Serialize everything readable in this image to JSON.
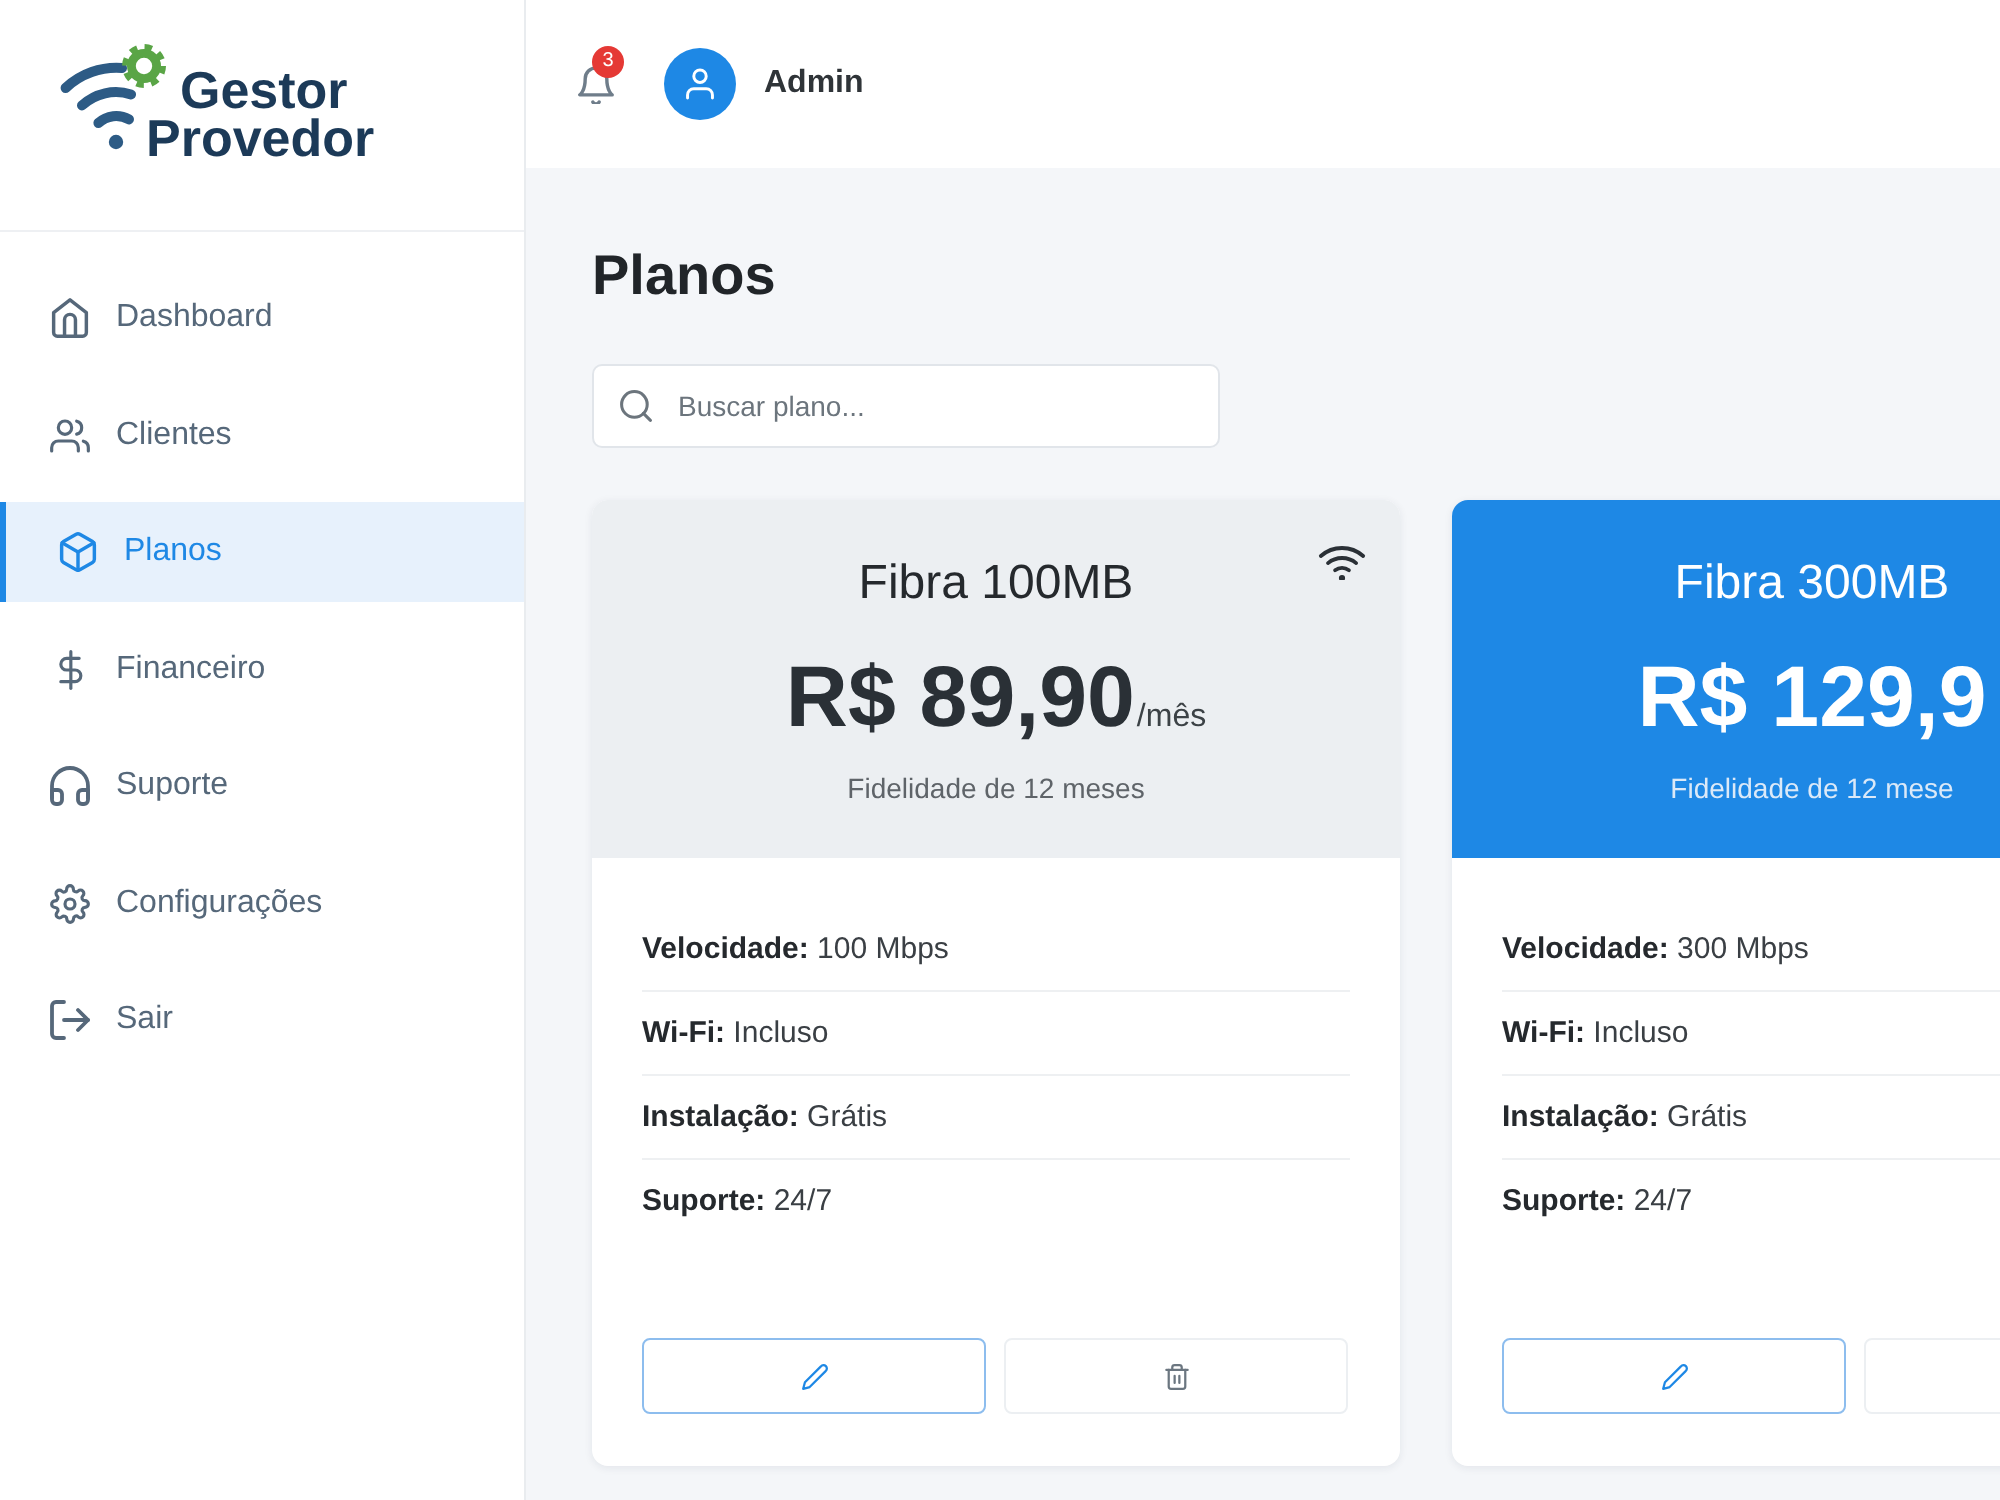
{
  "logo": [
    "Gestor",
    "Provedor"
  ],
  "sidebar": {
    "items": [
      {
        "kind": "home",
        "label": "Dashboard",
        "selected": false
      },
      {
        "kind": "users",
        "label": "Clientes",
        "selected": false
      },
      {
        "kind": "box",
        "label": "Planos",
        "selected": true
      },
      {
        "kind": "dollar",
        "label": "Financeiro",
        "selected": false
      },
      {
        "kind": "headphones",
        "label": "Suporte",
        "selected": false
      },
      {
        "kind": "gear",
        "label": "Configurações",
        "selected": false
      },
      {
        "kind": "logout",
        "label": "Sair",
        "selected": false
      }
    ]
  },
  "topbar": {
    "notification_count": "3",
    "user_name": "Admin"
  },
  "page": {
    "title": "Planos",
    "search": {
      "placeholder": "Buscar plano..."
    }
  },
  "plans": [
    {
      "name": "Fibra 100MB",
      "highlighted": false,
      "corner_icon": true,
      "price": "R$ 89,90",
      "period": "/mês",
      "note": "Fidelidade de 12 meses",
      "features": [
        "**Velocidade:** 100 Mbps",
        "**Wi-Fi:** Incluso",
        "**Instalação:** Grátis",
        "**Suporte:** 24/7"
      ],
      "actions": [
        {
          "kind": "edit"
        },
        {
          "kind": "delete"
        }
      ]
    },
    {
      "name": "Fibra 300MB",
      "highlighted": true,
      "corner_icon": false,
      "price": "R$ 129,9",
      "note": "Fidelidade de 12 mese",
      "features": [
        "**Velocidade:** 300 Mbps",
        "**Wi-Fi:** Incluso",
        "**Instalação:** Grátis",
        "**Suporte:** 24/7"
      ],
      "actions": [
        {
          "kind": "edit"
        },
        {
          "kind": "plain"
        }
      ]
    }
  ]
}
